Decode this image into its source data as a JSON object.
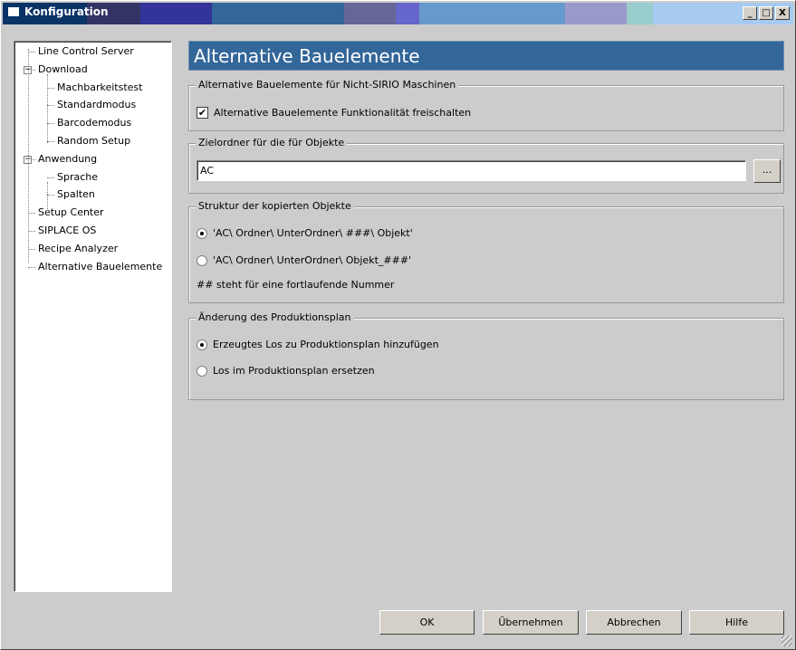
{
  "window": {
    "title": "Konfiguration",
    "minimize": "_",
    "maximize": "□",
    "close": "X",
    "title_colors": [
      "#0a3366",
      "#333366",
      "#333399",
      "#336699",
      "#666699",
      "#6666cc",
      "#6699cc",
      "#9999cc",
      "#99cccc",
      "#a6caf0"
    ]
  },
  "tree": [
    {
      "label": "Line Control Server",
      "level": 0
    },
    {
      "label": "Download",
      "level": 0,
      "expander": "−"
    },
    {
      "label": "Machbarkeitstest",
      "level": 1
    },
    {
      "label": "Standardmodus",
      "level": 1
    },
    {
      "label": "Barcodemodus",
      "level": 1
    },
    {
      "label": "Random Setup",
      "level": 1
    },
    {
      "label": "Anwendung",
      "level": 0,
      "expander": "−"
    },
    {
      "label": "Sprache",
      "level": 1
    },
    {
      "label": "Spalten",
      "level": 1
    },
    {
      "label": "Setup Center",
      "level": 0
    },
    {
      "label": "SIPLACE OS",
      "level": 0
    },
    {
      "label": "Recipe Analyzer",
      "level": 0
    },
    {
      "label": "Alternative Bauelemente",
      "level": 0
    }
  ],
  "header": "Alternative Bauelemente",
  "group1": {
    "legend": "Alternative Bauelemente für Nicht-SIRIO Maschinen",
    "checkbox": "Alternative Bauelemente Funktionalität freischalten",
    "checked": true,
    "check_mark": "✔"
  },
  "group2": {
    "legend": "Zielordner für die für Objekte",
    "value": "AC",
    "browse": "..."
  },
  "group3": {
    "legend": "Struktur der kopierten Objekte",
    "options": [
      "'AC\\ Ordner\\ UnterOrdner\\ ###\\ Objekt'",
      "'AC\\ Ordner\\ UnterOrdner\\ Objekt_###'"
    ],
    "selected": 0,
    "note": "## steht für eine fortlaufende Nummer"
  },
  "group4": {
    "legend": "Änderung des Produktionsplan",
    "options": [
      "Erzeugtes Los zu Produktionsplan hinzufügen",
      "Los im Produktionsplan ersetzen"
    ],
    "selected": 0
  },
  "buttons": {
    "ok": "OK",
    "apply": "Übernehmen",
    "cancel": "Abbrechen",
    "help": "Hilfe"
  }
}
